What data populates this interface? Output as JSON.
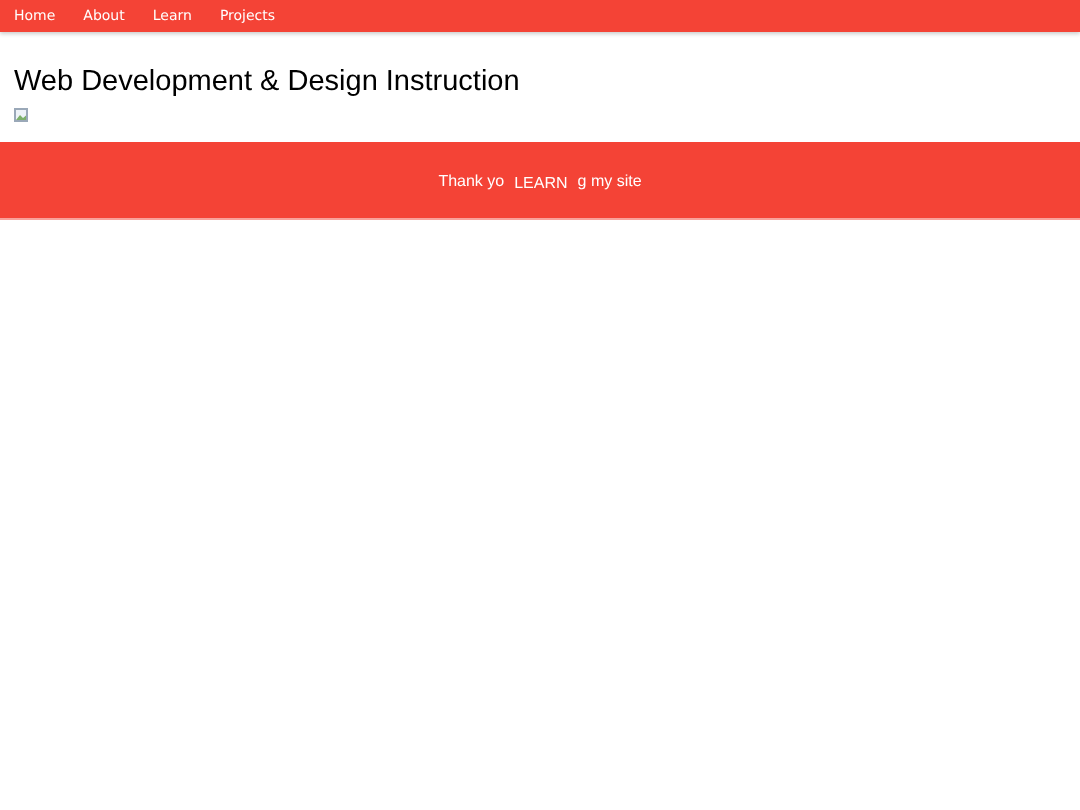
{
  "nav": {
    "items": [
      {
        "label": "Home"
      },
      {
        "label": "About"
      },
      {
        "label": "Learn"
      },
      {
        "label": "Projects"
      }
    ]
  },
  "heading": "Web Development & Design Instruction",
  "banner": {
    "text_before": "Thank yo",
    "button": "LEARN",
    "text_after": "g my site"
  }
}
